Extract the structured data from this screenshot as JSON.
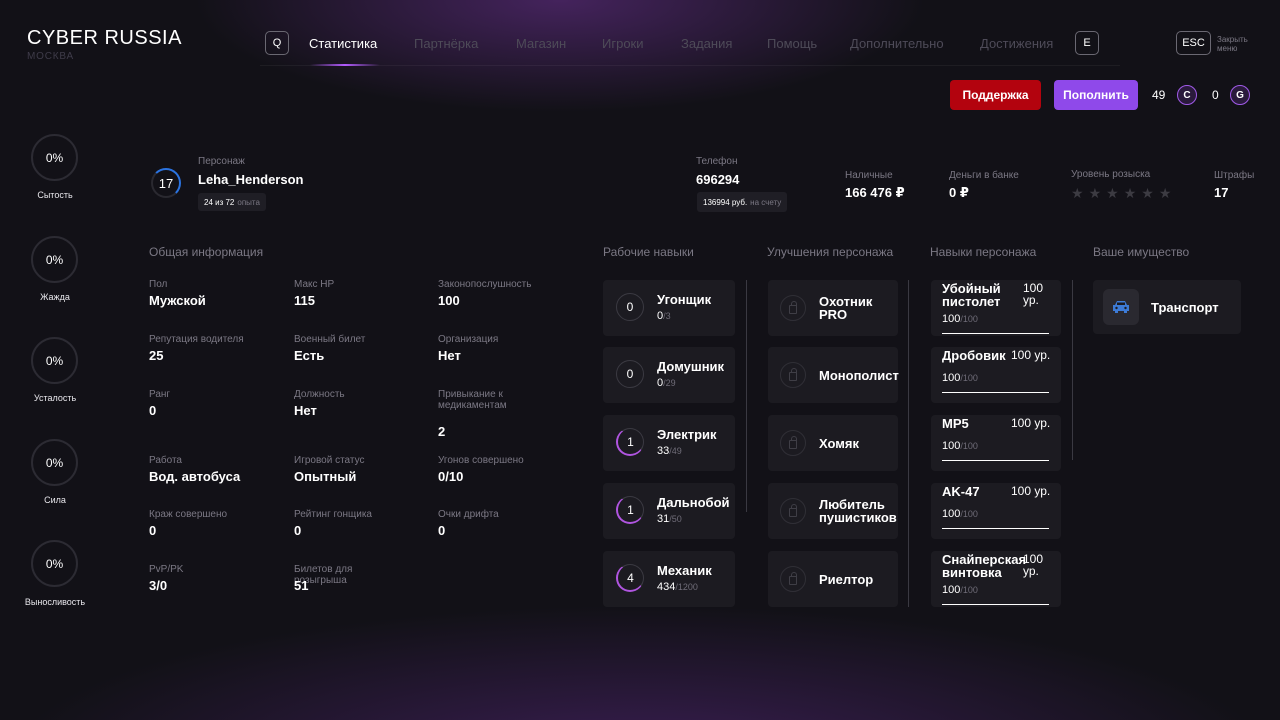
{
  "header": {
    "brand": "CYBER RUSSIA",
    "city": "МОСКВА",
    "key_prev": "Q",
    "key_next": "E",
    "key_esc": "ESC",
    "close_label": "Закрыть меню",
    "tabs": [
      {
        "label": "Статистика",
        "active": true
      },
      {
        "label": "Партнёрка"
      },
      {
        "label": "Магазин"
      },
      {
        "label": "Игроки"
      },
      {
        "label": "Задания"
      },
      {
        "label": "Помощь"
      },
      {
        "label": "Дополнительно"
      },
      {
        "label": "Достижения"
      }
    ]
  },
  "actions": {
    "support_label": "Поддержка",
    "topup_label": "Пополнить",
    "currency_c_amount": "49",
    "currency_c_icon": "C",
    "currency_g_amount": "0",
    "currency_g_icon": "G"
  },
  "needs": [
    {
      "value": "0%",
      "label": "Сытость"
    },
    {
      "value": "0%",
      "label": "Жажда"
    },
    {
      "value": "0%",
      "label": "Усталость"
    },
    {
      "value": "0%",
      "label": "Сила"
    },
    {
      "value": "0%",
      "label": "Выносливость"
    }
  ],
  "profile": {
    "level": "17",
    "character_label": "Персонаж",
    "character_name": "Leha_Henderson",
    "xp_value": "24 из 72",
    "xp_suffix": "опыта",
    "phone_label": "Телефон",
    "phone_value": "696294",
    "phone_balance": "136994 руб.",
    "phone_balance_suffix": "на счету",
    "cash_label": "Наличные",
    "cash_value": "166 476 ₽",
    "bank_label": "Деньги в банке",
    "bank_value": "0 ₽",
    "wanted_label": "Уровень розыска",
    "wanted_level": 0,
    "wanted_max": 6,
    "fines_label": "Штрафы",
    "fines_value": "17"
  },
  "general": {
    "title": "Общая информация",
    "fields": [
      {
        "label": "Пол",
        "value": "Мужской"
      },
      {
        "label": "Макс HP",
        "value": "115"
      },
      {
        "label": "Законопослушность",
        "value": "100"
      },
      {
        "label": "Репутация водителя",
        "value": "25"
      },
      {
        "label": "Военный билет",
        "value": "Есть"
      },
      {
        "label": "Организация",
        "value": "Нет"
      },
      {
        "label": "Ранг",
        "value": "0"
      },
      {
        "label": "Должность",
        "value": "Нет"
      },
      {
        "label": "Привыкание к медикаментам",
        "value": "2"
      },
      {
        "label": "Работа",
        "value": "Вод. автобуса"
      },
      {
        "label": "Игровой статус",
        "value": "Опытный"
      },
      {
        "label": "Угонов совершено",
        "value": "0/10"
      },
      {
        "label": "Краж совершено",
        "value": "0"
      },
      {
        "label": "Рейтинг гонщика",
        "value": "0"
      },
      {
        "label": "Очки дрифта",
        "value": "0"
      },
      {
        "label": "PvP/PK",
        "value": "3/0"
      },
      {
        "label": "Билетов для розыгрыша",
        "value": "51"
      }
    ]
  },
  "work_skills": {
    "title": "Рабочие навыки",
    "items": [
      {
        "level": "0",
        "name": "Угонщик",
        "current": "0",
        "max": "/3",
        "progress": 0
      },
      {
        "level": "0",
        "name": "Домушник",
        "current": "0",
        "max": "/29",
        "progress": 0
      },
      {
        "level": "1",
        "name": "Электрик",
        "current": "33",
        "max": "/49",
        "progress": 0.67
      },
      {
        "level": "1",
        "name": "Дальнобой",
        "current": "31",
        "max": "/50",
        "progress": 0.62
      },
      {
        "level": "4",
        "name": "Механик",
        "current": "434",
        "max": "/1200",
        "progress": 0.36
      }
    ]
  },
  "upgrades": {
    "title": "Улучшения персонажа",
    "items": [
      {
        "line1": "Охотник",
        "line2": "PRO"
      },
      {
        "line1": "Монополист",
        "line2": ""
      },
      {
        "line1": "Хомяк",
        "line2": ""
      },
      {
        "line1": "Любитель",
        "line2": "пушистиков"
      },
      {
        "line1": "Риелтор",
        "line2": ""
      }
    ]
  },
  "char_skills": {
    "title": "Навыки персонажа",
    "items": [
      {
        "line1": "Убойный",
        "line2": "пистолет",
        "lvl1": "100",
        "lvl2": "ур.",
        "current": "100",
        "max": "/100",
        "progress": 1
      },
      {
        "line1": "Дробовик",
        "line2": "",
        "lvl1": "100 ур.",
        "lvl2": "",
        "current": "100",
        "max": "/100",
        "progress": 1
      },
      {
        "line1": "MP5",
        "line2": "",
        "lvl1": "100 ур.",
        "lvl2": "",
        "current": "100",
        "max": "/100",
        "progress": 1
      },
      {
        "line1": "AK-47",
        "line2": "",
        "lvl1": "100 ур.",
        "lvl2": "",
        "current": "100",
        "max": "/100",
        "progress": 1
      },
      {
        "line1": "Снайперская",
        "line2": "винтовка",
        "lvl1": "100",
        "lvl2": "ур.",
        "current": "100",
        "max": "/100",
        "progress": 1
      }
    ]
  },
  "property": {
    "title": "Ваше имущество",
    "items": [
      {
        "label": "Транспорт",
        "icon": "car-icon"
      }
    ]
  }
}
